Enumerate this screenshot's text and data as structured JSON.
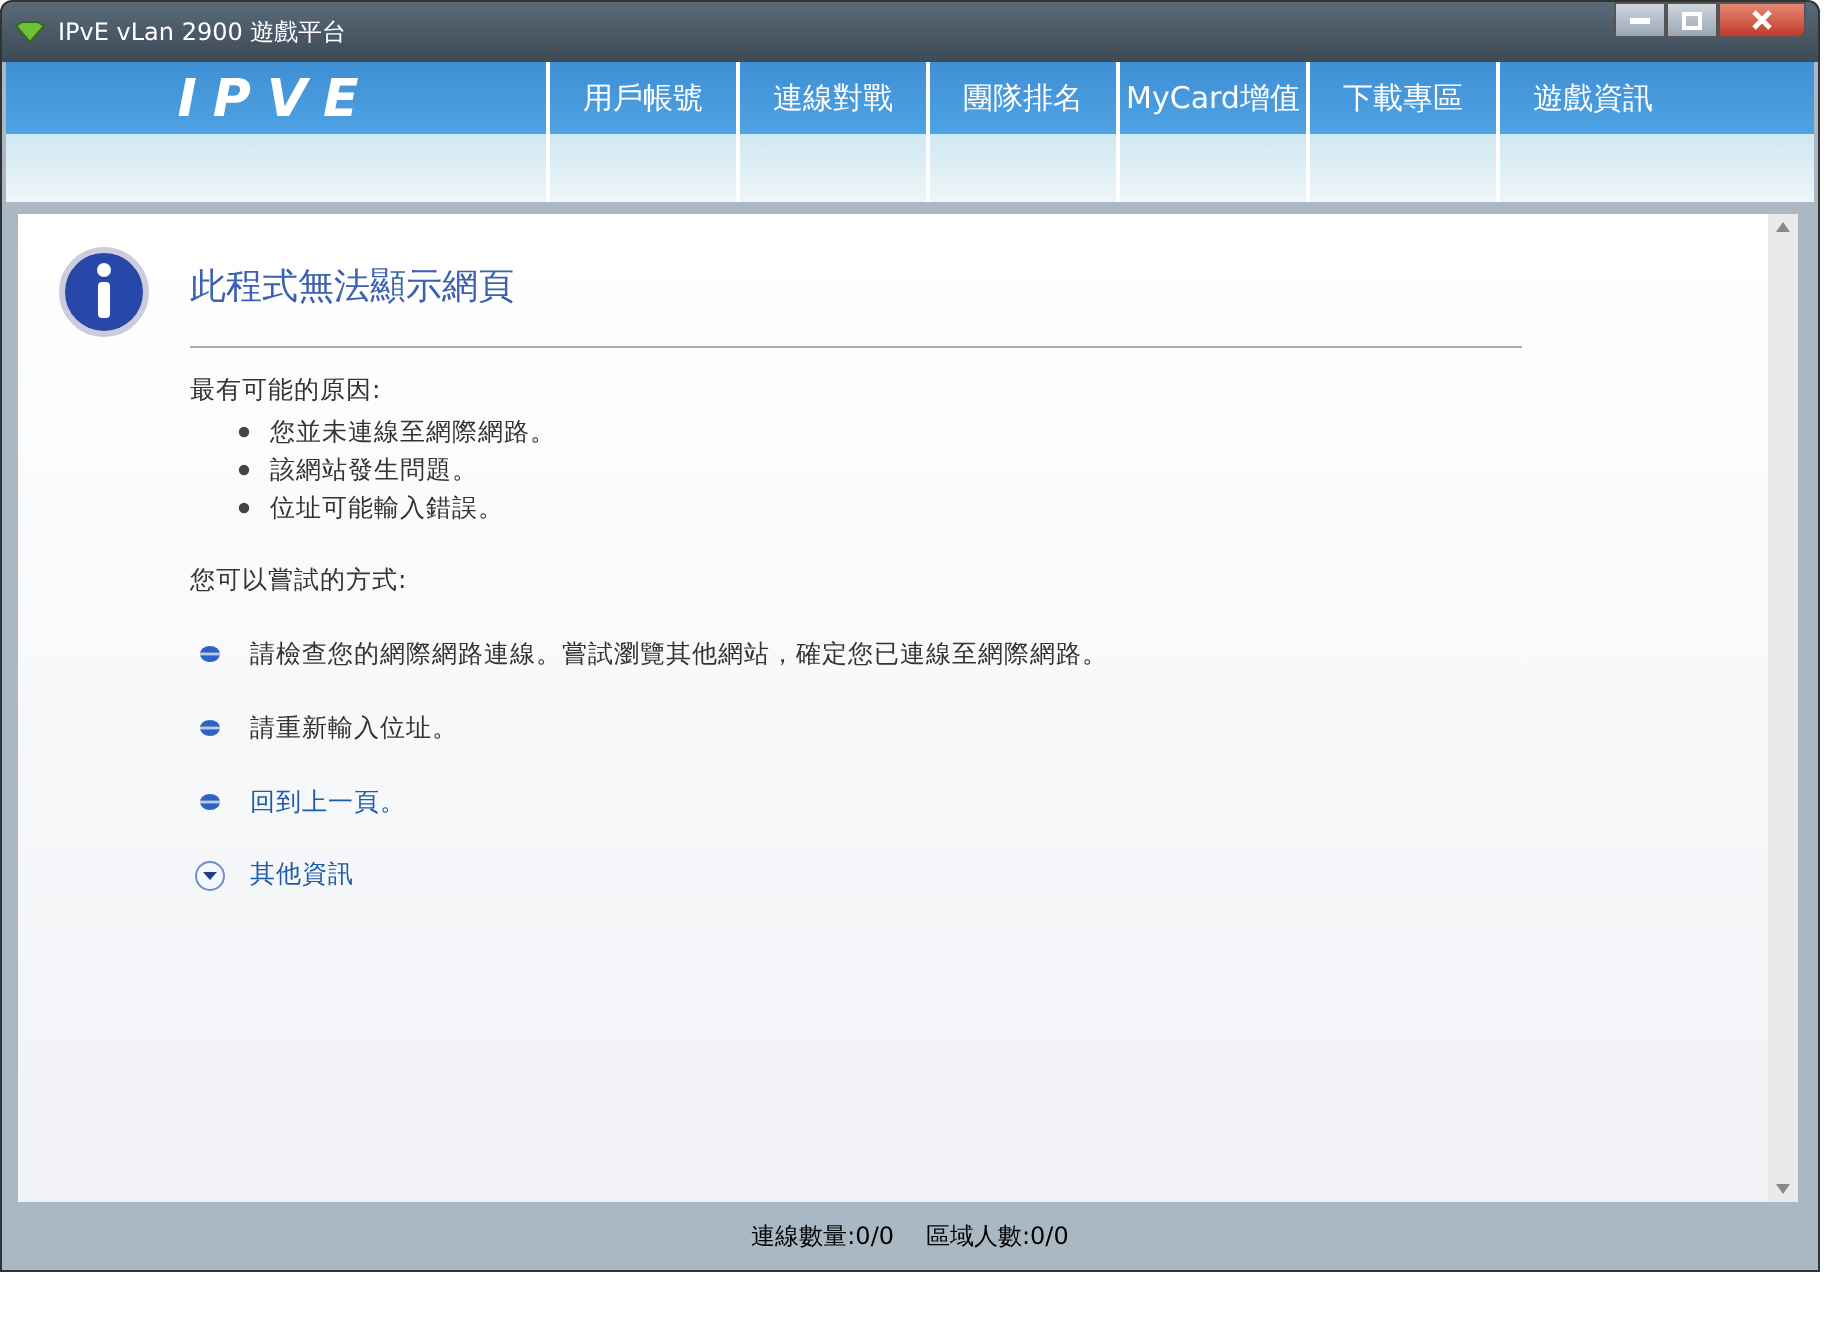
{
  "window": {
    "title": "IPvE vLan 2900 遊戲平台"
  },
  "header": {
    "logo": "IPVE",
    "nav": [
      {
        "label": "用戶帳號"
      },
      {
        "label": "連線對戰"
      },
      {
        "label": "團隊排名"
      },
      {
        "label": "MyCard增值"
      },
      {
        "label": "下載專區"
      },
      {
        "label": "遊戲資訊"
      }
    ]
  },
  "error_page": {
    "title": "此程式無法顯示網頁",
    "causes_heading": "最有可能的原因:",
    "causes": [
      "您並未連線至網際網路。",
      "該網站發生問題。",
      "位址可能輸入錯誤。"
    ],
    "tries_heading": "您可以嘗試的方式:",
    "tries": [
      {
        "kind": "text",
        "text": "請檢查您的網際網路連線。嘗試瀏覽其他網站，確定您已連線至網際網路。"
      },
      {
        "kind": "text",
        "text": "請重新輸入位址。"
      },
      {
        "kind": "link",
        "text": "回到上一頁。"
      },
      {
        "kind": "expander",
        "text": "其他資訊",
        "expanded": false
      }
    ]
  },
  "status_bar": [
    "連線數量:0/0",
    "區域人數:0/0"
  ]
}
